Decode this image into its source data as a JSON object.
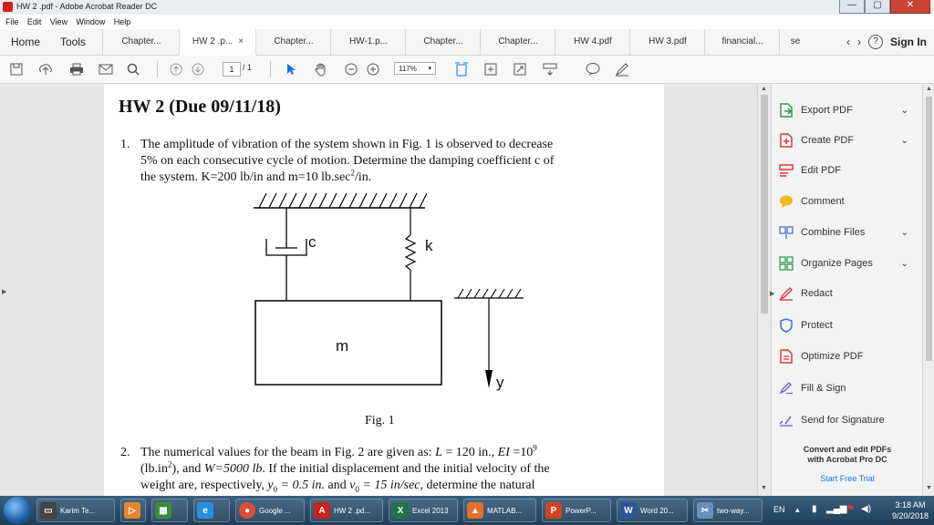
{
  "window": {
    "title": "HW 2 .pdf - Adobe Acrobat Reader DC",
    "buttons": {
      "minimize": "—",
      "maximize": "▢",
      "close": "✕"
    }
  },
  "menu": [
    "File",
    "Edit",
    "View",
    "Window",
    "Help"
  ],
  "tabs": {
    "home": "Home",
    "tools": "Tools",
    "docs": [
      "Chapter...",
      "HW 2 .p...",
      "Chapter...",
      "HW-1.p...",
      "Chapter...",
      "Chapter...",
      "HW 4.pdf",
      "HW 3.pdf",
      "financial...",
      "se"
    ],
    "active_close": "×",
    "help": "?",
    "sign_in": "Sign In"
  },
  "toolbar": {
    "page_current": "1",
    "page_total": "/ 1",
    "zoom": "117%"
  },
  "document": {
    "title": "HW 2 (Due 09/11/18)",
    "p1_num": "1.",
    "p1_line1": "The amplitude of vibration of the system shown in Fig. 1 is observed to decrease",
    "p1_line2": "5% on each consecutive cycle of motion. Determine the damping coefficient c of",
    "p1_line3a": "the system. K=200 lb/in and m=10 lb.sec",
    "p1_sup": "2",
    "p1_line3b": "/in.",
    "fig_labels": {
      "c": "c",
      "k": "k",
      "m": "m",
      "y": "y"
    },
    "fig_caption": "Fig. 1",
    "p2_num": "2.",
    "p2_line1a": "The numerical values for the beam in Fig. 2 are given as: ",
    "p2_L": "L",
    "p2_line1b": " = 120 in., ",
    "p2_EI": "EI",
    "p2_line1c": " =10",
    "p2_sup9": "9",
    "p2_line2a": "(lb.in",
    "p2_sup2": "2",
    "p2_line2b": "), and ",
    "p2_W": "W=5000 lb",
    "p2_line2c": ". If the initial displacement and the initial velocity of the",
    "p2_line3a": "weight are, respectively, ",
    "p2_y0": "y",
    "p2_y0sub": "0",
    "p2_y0val": " = 0.5 in.",
    "p2_line3b": " and ",
    "p2_v0": "v",
    "p2_v0sub": "0",
    "p2_v0val": " = 15 in/sec,",
    "p2_line3c": " determine the natural"
  },
  "right_panel": {
    "items": [
      {
        "label": "Export PDF",
        "icon": "export-pdf-icon",
        "chevron": true,
        "color": "#2d9d4a"
      },
      {
        "label": "Create PDF",
        "icon": "create-pdf-icon",
        "chevron": true,
        "color": "#e0383e"
      },
      {
        "label": "Edit PDF",
        "icon": "edit-pdf-icon",
        "chevron": false,
        "color": "#e0383e"
      },
      {
        "label": "Comment",
        "icon": "comment-icon",
        "chevron": false,
        "color": "#f2b91e"
      },
      {
        "label": "Combine Files",
        "icon": "combine-files-icon",
        "chevron": true,
        "color": "#4a6ee0"
      },
      {
        "label": "Organize Pages",
        "icon": "organize-pages-icon",
        "chevron": true,
        "color": "#2d9d4a"
      },
      {
        "label": "Redact",
        "icon": "redact-icon",
        "chevron": false,
        "color": "#e0383e"
      },
      {
        "label": "Protect",
        "icon": "protect-icon",
        "chevron": false,
        "color": "#3d6fd9"
      },
      {
        "label": "Optimize PDF",
        "icon": "optimize-pdf-icon",
        "chevron": false,
        "color": "#e0383e"
      },
      {
        "label": "Fill & Sign",
        "icon": "fill-sign-icon",
        "chevron": false,
        "color": "#7b5cd6"
      },
      {
        "label": "Send for Signature",
        "icon": "send-signature-icon",
        "chevron": false,
        "color": "#7b5cd6"
      }
    ],
    "promo_line1": "Convert and edit PDFs",
    "promo_line2": "with Acrobat Pro DC",
    "trial": "Start Free Trial"
  },
  "taskbar": {
    "items": [
      "Karim Te...",
      "Google ...",
      "HW 2 .pd...",
      "Excel 2013",
      "MATLAB...",
      "PowerP...",
      "Word 20...",
      "two-way..."
    ],
    "lang": "EN",
    "time": "3:18 AM",
    "date": "9/20/2018"
  }
}
